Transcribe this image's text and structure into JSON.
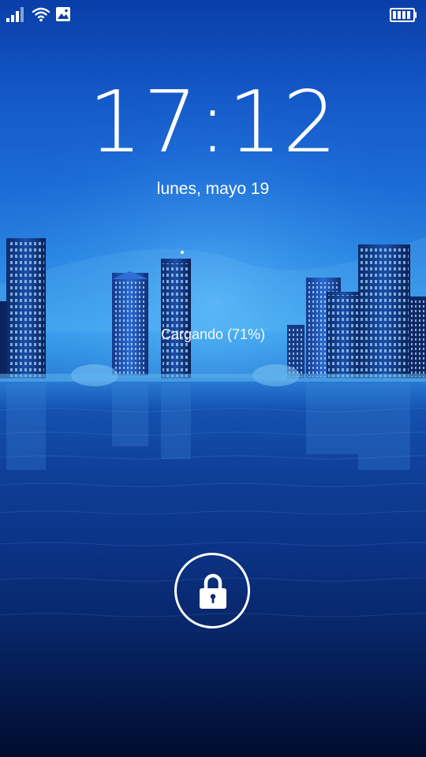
{
  "status_bar": {
    "icons": [
      "signal-icon",
      "wifi-icon",
      "gallery-icon",
      "battery-icon"
    ]
  },
  "lock_screen": {
    "time": "17:12",
    "date": "lunes, mayo 19",
    "charging_status": "Cargando (71%)",
    "battery_level": 0.71,
    "unlock_icon": "lock-icon"
  },
  "colors": {
    "text": "#ffffff",
    "sky_top": "#0a3ea8",
    "sky_glow": "#3ba2ee",
    "water_bottom": "#020d2e"
  }
}
